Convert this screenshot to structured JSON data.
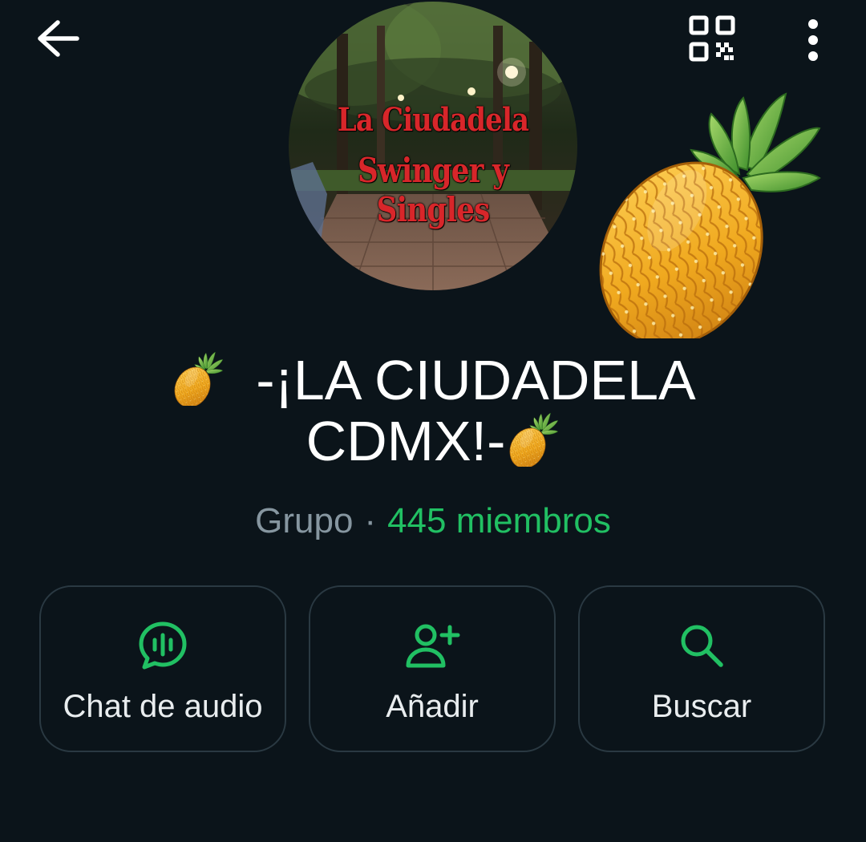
{
  "header": {
    "back_icon": "arrow-left-icon",
    "qr_icon": "qr-code-icon",
    "menu_icon": "more-vertical-icon"
  },
  "avatar": {
    "line1": "La Ciudadela",
    "line2": "Swinger y Singles"
  },
  "group": {
    "title_line1": "-¡LA CIUDADELA",
    "title_line2": "CDMX!-",
    "kind": "Grupo",
    "separator": "·",
    "members": "445 miembros"
  },
  "actions": [
    {
      "label": "Chat de audio",
      "icon": "audio-chat-icon"
    },
    {
      "label": "Añadir",
      "icon": "add-person-icon"
    },
    {
      "label": "Buscar",
      "icon": "search-icon"
    }
  ],
  "colors": {
    "background": "#0b141a",
    "accent": "#21c063",
    "secondary_text": "#8696a0",
    "border": "#2a3942"
  }
}
